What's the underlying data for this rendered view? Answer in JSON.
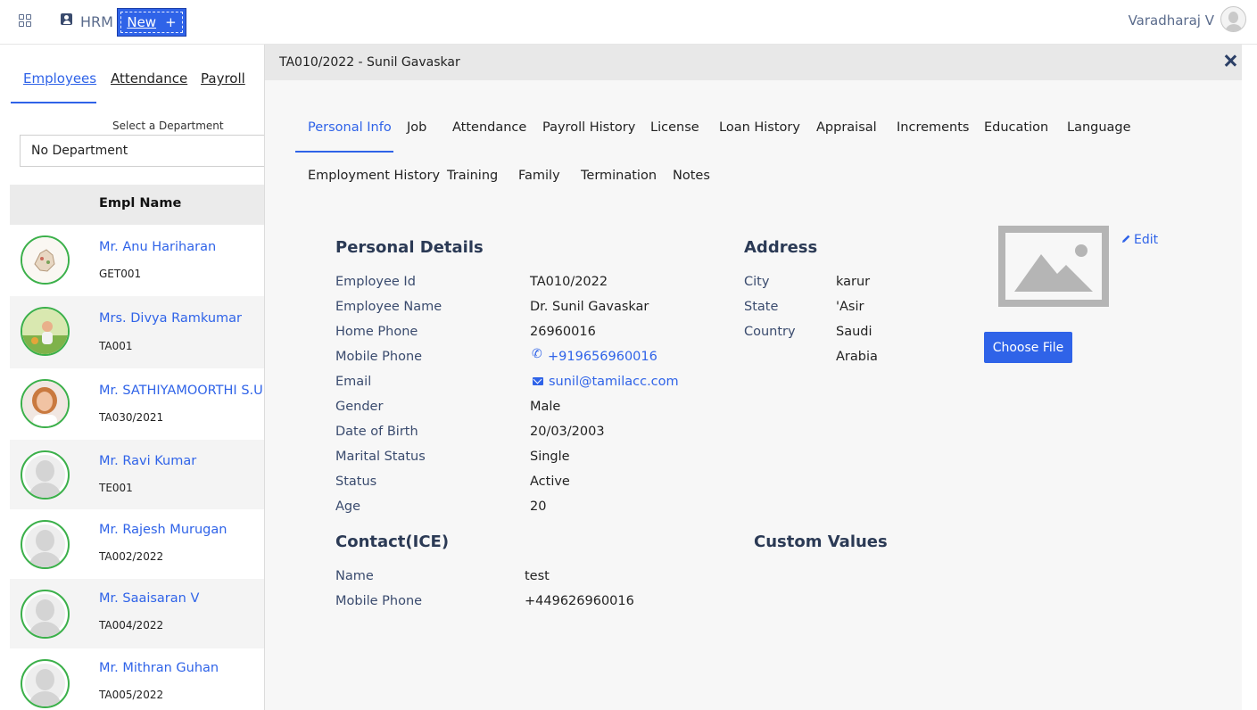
{
  "topbar": {
    "app_name": "HRM",
    "new_label": "New",
    "new_plus": "+",
    "user_name": "Varadharaj V"
  },
  "left": {
    "tabs": [
      "Employees",
      "Attendance",
      "Payroll"
    ],
    "dept_label": "Select a Department",
    "dept_value": "No Department",
    "column_header": "Empl Name",
    "employees": [
      {
        "name": "Mr. Anu Hariharan",
        "code": "GET001"
      },
      {
        "name": "Mrs. Divya Ramkumar",
        "code": "TA001"
      },
      {
        "name": "Mr. SATHIYAMOORTHI S.U",
        "code": "TA030/2021"
      },
      {
        "name": "Mr. Ravi Kumar",
        "code": "TE001"
      },
      {
        "name": "Mr. Rajesh Murugan",
        "code": "TA002/2022"
      },
      {
        "name": "Mr. Saaisaran V",
        "code": "TA004/2022"
      },
      {
        "name": "Mr. Mithran Guhan",
        "code": "TA005/2022"
      }
    ]
  },
  "detail": {
    "title": "TA010/2022 - Sunil Gavaskar",
    "tabs_row1": [
      "Personal Info",
      "Job",
      "Attendance",
      "Payroll History",
      "License",
      "Loan History",
      "Appraisal",
      "Increments",
      "Education",
      "Language"
    ],
    "tabs_row2": [
      "Employment History",
      "Training",
      "Family",
      "Termination",
      "Notes"
    ],
    "personal": {
      "heading": "Personal Details",
      "fields": [
        {
          "label": "Employee Id",
          "value": "TA010/2022"
        },
        {
          "label": "Employee Name",
          "value": "Dr. Sunil Gavaskar"
        },
        {
          "label": "Home Phone",
          "value": "26960016"
        },
        {
          "label": "Mobile Phone",
          "value": "+919656960016"
        },
        {
          "label": "Email",
          "value": "sunil@tamilacc.com"
        },
        {
          "label": "Gender",
          "value": "Male"
        },
        {
          "label": "Date of Birth",
          "value": "20/03/2003"
        },
        {
          "label": "Marital Status",
          "value": "Single"
        },
        {
          "label": "Status",
          "value": "Active"
        },
        {
          "label": "Age",
          "value": "20"
        }
      ]
    },
    "address": {
      "heading": "Address",
      "fields": [
        {
          "label": "City",
          "value": "karur"
        },
        {
          "label": "State",
          "value": "'Asir"
        },
        {
          "label": "Country",
          "value": "Saudi"
        },
        {
          "label": "",
          "value": "Arabia"
        }
      ]
    },
    "contact": {
      "heading": "Contact(ICE)",
      "fields": [
        {
          "label": "Name",
          "value": "test"
        },
        {
          "label": "Mobile Phone",
          "value": "+449626960016"
        }
      ]
    },
    "custom_values_heading": "Custom Values",
    "edit_label": "Edit",
    "choose_file_label": "Choose File"
  }
}
